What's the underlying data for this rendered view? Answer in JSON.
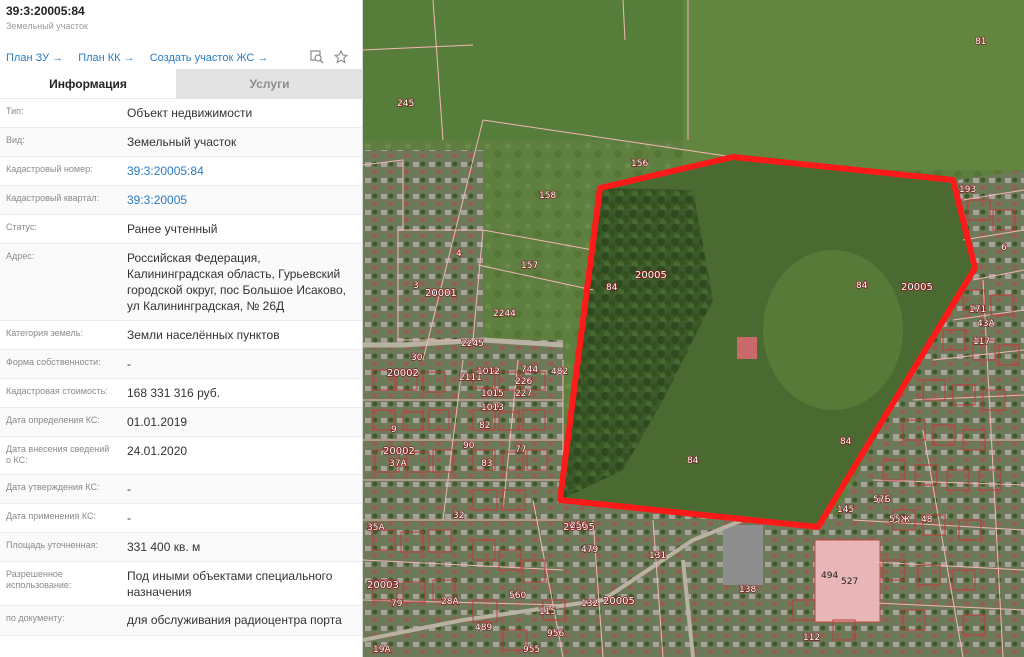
{
  "header": {
    "cadastral_number": "39:3:20005:84",
    "object_type": "Земельный участок"
  },
  "links": [
    {
      "label": "План ЗУ →"
    },
    {
      "label": "План КК →"
    },
    {
      "label": "Создать участок ЖС →"
    }
  ],
  "icons": [
    "search-map-icon",
    "star-icon"
  ],
  "tabs": {
    "info": "Информация",
    "services": "Услуги"
  },
  "rows": [
    {
      "key": "Тип:",
      "value": "Объект недвижимости"
    },
    {
      "key": "Вид:",
      "value": "Земельный участок"
    },
    {
      "key": "Кадастровый номер:",
      "value": "39:3:20005:84",
      "link": true
    },
    {
      "key": "Кадастровый квартал:",
      "value": "39:3:20005",
      "link": true
    },
    {
      "key": "Статус:",
      "value": "Ранее учтенный"
    },
    {
      "key": "Адрес:",
      "value": "Российская Федерация, Калининградская область, Гурьевский городской округ, пос Большое Исаково, ул Калининградская, № 26Д"
    },
    {
      "key": "Категория земель:",
      "value": "Земли населённых пунктов"
    },
    {
      "key": "Форма собственности:",
      "value": "-"
    },
    {
      "key": "Кадастровая стоимость:",
      "value": "168 331 316 руб."
    },
    {
      "key": "Дата определения КС:",
      "value": "01.01.2019"
    },
    {
      "key": "Дата внесения сведений о КС:",
      "value": "24.01.2020"
    },
    {
      "key": "Дата утверждения КС:",
      "value": "-"
    },
    {
      "key": "Дата применения КС:",
      "value": "-"
    },
    {
      "key": "Площадь уточненная:",
      "value": "331 400 кв. м"
    },
    {
      "key": "Разрешенное использование:",
      "value": "Под иными объектами специального назначения"
    },
    {
      "key": "по документу:",
      "value": "для обслуживания радиоцентра порта"
    }
  ],
  "map": {
    "highlight_color": "#ff1a1a",
    "parcel_labels": [
      "81",
      "245",
      "156",
      "158",
      "193",
      "20005",
      "84",
      "20005",
      "84",
      "84",
      "84",
      "4",
      "157",
      "3",
      "20001",
      "2244",
      "2245",
      "30",
      "20002",
      "2111",
      "1012",
      "744",
      "482",
      "20002",
      "37А",
      "9",
      "1015",
      "226",
      "227",
      "1013",
      "90",
      "83",
      "82",
      "77",
      "32",
      "20005",
      "256",
      "131",
      "479",
      "138",
      "494",
      "527",
      "20003",
      "35А",
      "132",
      "20005",
      "57Б",
      "55Ж",
      "48",
      "145",
      "43А",
      "171",
      "117",
      "19А",
      "956",
      "955",
      "560",
      "489",
      "79",
      "28А",
      "115",
      "112",
      "6"
    ]
  }
}
